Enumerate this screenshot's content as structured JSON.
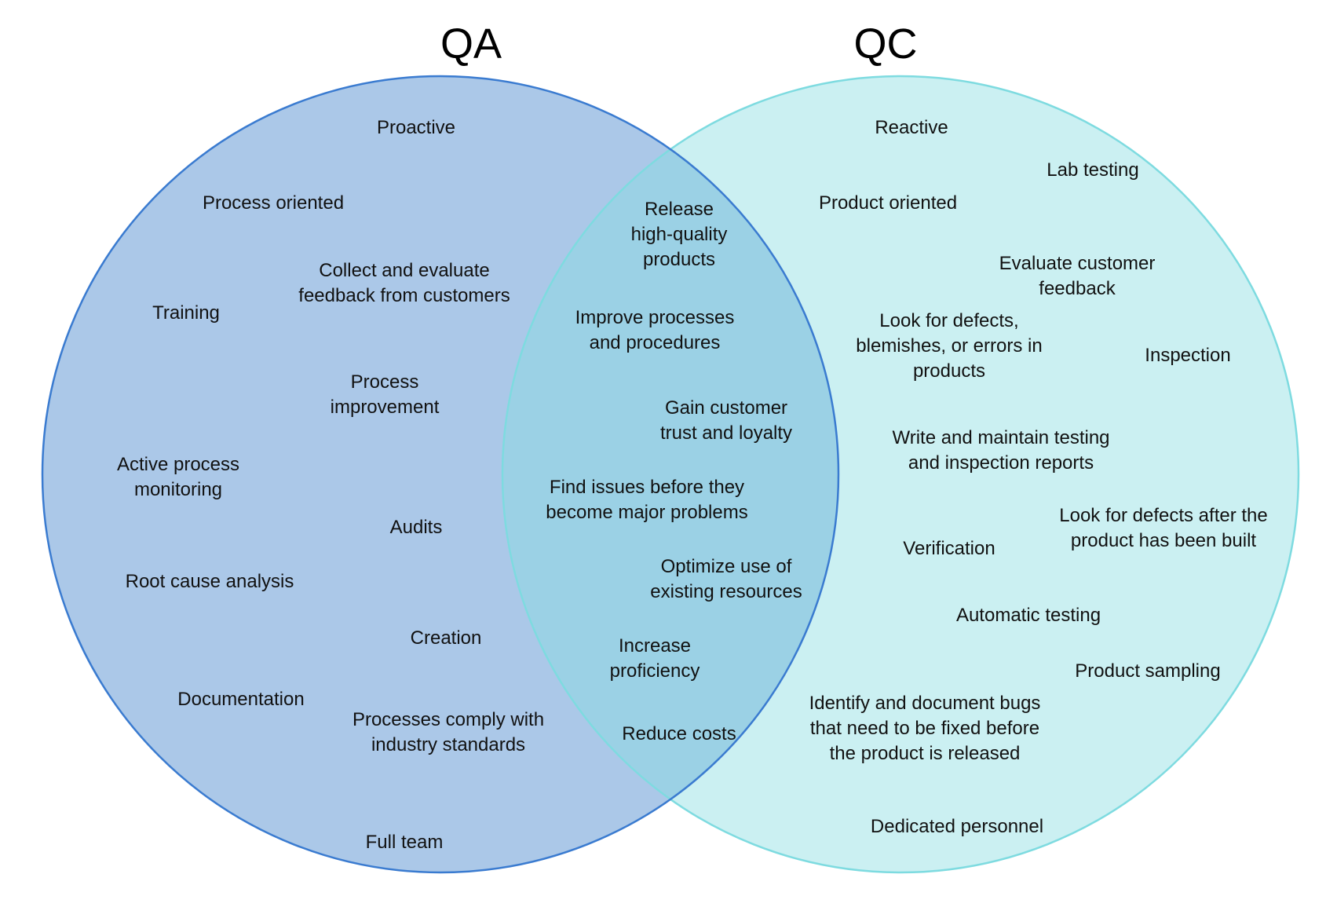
{
  "colors": {
    "qa_fill": "#abc8e8",
    "qa_stroke": "#3a7bd0",
    "qc_fill": "#cbf0f2",
    "qc_stroke": "#7edbe0",
    "overlap_fill": "#9bd1e5",
    "text": "#111111"
  },
  "sets": {
    "qa": {
      "title": "QA"
    },
    "qc": {
      "title": "QC"
    }
  },
  "regions": {
    "qa_only": [
      [
        "Proactive"
      ],
      [
        "Process oriented"
      ],
      [
        "Collect and evaluate",
        "feedback from customers"
      ],
      [
        "Training"
      ],
      [
        "Process",
        "improvement"
      ],
      [
        "Active process",
        "monitoring"
      ],
      [
        "Audits"
      ],
      [
        "Root cause analysis"
      ],
      [
        "Creation"
      ],
      [
        "Documentation"
      ],
      [
        "Processes comply with",
        "industry standards"
      ],
      [
        "Full team"
      ]
    ],
    "both": [
      [
        "Release",
        "high-quality",
        "products"
      ],
      [
        "Improve processes",
        "and procedures"
      ],
      [
        "Gain customer",
        "trust and loyalty"
      ],
      [
        "Find issues before they",
        "become major problems"
      ],
      [
        "Optimize use of",
        "existing resources"
      ],
      [
        "Increase",
        "proficiency"
      ],
      [
        "Reduce costs"
      ]
    ],
    "qc_only": [
      [
        "Reactive"
      ],
      [
        "Lab testing"
      ],
      [
        "Product oriented"
      ],
      [
        "Evaluate customer",
        "feedback"
      ],
      [
        "Look for defects,",
        "blemishes, or errors in",
        "products"
      ],
      [
        "Inspection"
      ],
      [
        "Write and maintain testing",
        "and inspection reports"
      ],
      [
        "Look for defects after the",
        "product has been built"
      ],
      [
        "Verification"
      ],
      [
        "Automatic testing"
      ],
      [
        "Product sampling"
      ],
      [
        "Identify and document bugs",
        "that need to be fixed before",
        "the product is released"
      ],
      [
        "Dedicated personnel"
      ]
    ]
  }
}
